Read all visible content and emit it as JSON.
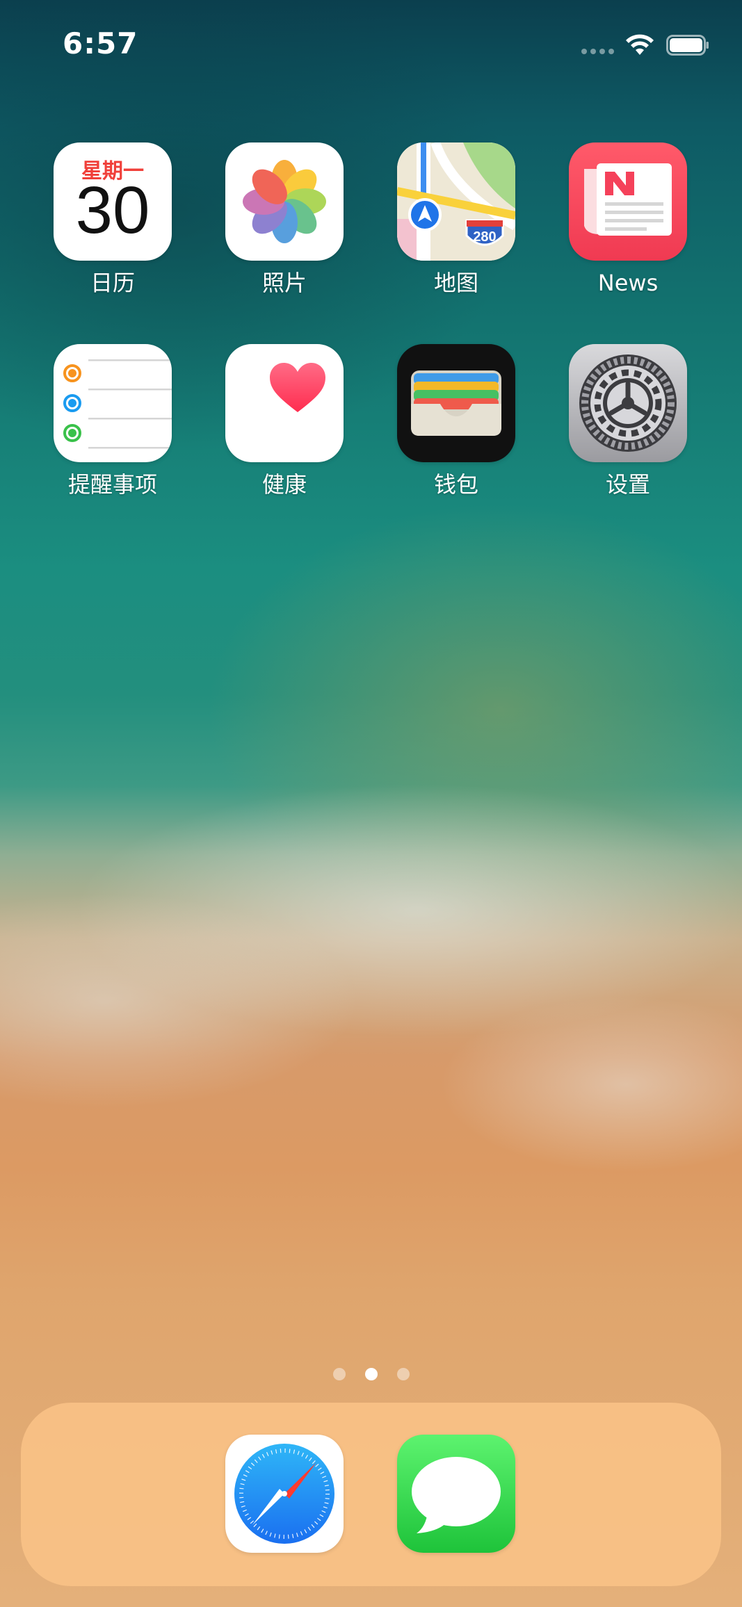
{
  "status_bar": {
    "time": "6:57",
    "icons": [
      "cellular-signal-icon",
      "wifi-icon",
      "battery-icon"
    ]
  },
  "home_screen": {
    "apps": [
      {
        "name": "calendar",
        "label": "日历",
        "weekday": "星期一",
        "day": "30"
      },
      {
        "name": "photos",
        "label": "照片"
      },
      {
        "name": "maps",
        "label": "地图",
        "shield_number": "280"
      },
      {
        "name": "news",
        "label": "News"
      },
      {
        "name": "reminders",
        "label": "提醒事项"
      },
      {
        "name": "health",
        "label": "健康"
      },
      {
        "name": "wallet",
        "label": "钱包"
      },
      {
        "name": "settings",
        "label": "设置"
      }
    ],
    "page_indicator": {
      "pages": 3,
      "current_page": 2
    }
  },
  "dock": {
    "apps": [
      {
        "name": "safari",
        "icon": "compass-icon"
      },
      {
        "name": "messages",
        "icon": "speech-bubble-icon"
      }
    ]
  },
  "colors": {
    "calendar_red": "#f0403a",
    "news_red": "#f54a5e",
    "health_pink": "#ff3b5c",
    "messages_green": "#2fd44b",
    "safari_blue": "#1c7cf4",
    "dock": "#f8c184"
  }
}
